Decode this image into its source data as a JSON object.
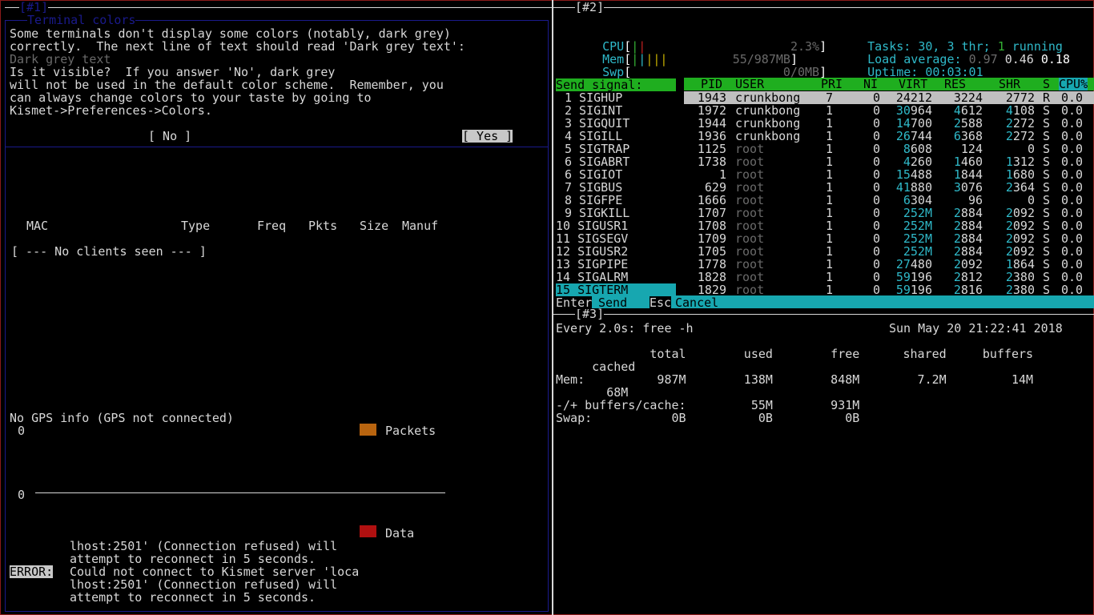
{
  "pane1": {
    "id": "[#1]",
    "dialog": {
      "title": "Terminal colors",
      "lines": [
        "Some terminals don't display some colors (notably, dark grey)",
        "correctly.  The next line of text should read 'Dark grey text':",
        "Dark grey text",
        "Is it visible?  If you answer 'No', dark grey",
        "will not be used in the default color scheme.  Remember, you",
        "can always change colors to your taste by going to",
        "Kismet->Preferences->Colors."
      ],
      "no_button": "[ No ]",
      "yes_button": "[ Yes ]"
    },
    "clients": {
      "headers": [
        "MAC",
        "Type",
        "Freq",
        "Pkts",
        "Size",
        "Manuf"
      ],
      "empty": "[ --- No clients seen --- ]"
    },
    "gps": "No GPS info (GPS not connected)",
    "graph": {
      "top_zero": "0",
      "mid_zero": "0",
      "legend_packets": "Packets",
      "legend_data": "Data",
      "packets_color": "#b8640f",
      "data_color": "#b01010"
    },
    "log": [
      "lhost:2501' (Connection refused) will",
      "attempt to reconnect in 5 seconds.",
      "Could not connect to Kismet server 'loca",
      "lhost:2501' (Connection refused) will",
      "attempt to reconnect in 5 seconds."
    ],
    "error_tag": "ERROR:"
  },
  "pane2": {
    "id": "[#2]",
    "meters": {
      "cpu_label": "CPU",
      "cpu_value": "2.3%",
      "mem_label": "Mem",
      "mem_value": "55/987MB",
      "swp_label": "Swp",
      "swp_value": "0/0MB"
    },
    "stats": {
      "tasks_label": "Tasks:",
      "tasks_value": "30,",
      "thr_value": "3",
      "thr_label": "thr;",
      "running_value": "1",
      "running_label": "running",
      "load_label": "Load average:",
      "load_1": "0.97",
      "load_5": "0.46",
      "load_15": "0.18",
      "uptime_label": "Uptime:",
      "uptime_value": "00:03:01"
    },
    "send_signal_title": "Send signal:",
    "signals": [
      "1 SIGHUP",
      "2 SIGINT",
      "3 SIGQUIT",
      "4 SIGILL",
      "5 SIGTRAP",
      "6 SIGABRT",
      "6 SIGIOT",
      "7 SIGBUS",
      "8 SIGFPE",
      "9 SIGKILL",
      "10 SIGUSR1",
      "11 SIGSEGV",
      "12 SIGUSR2",
      "13 SIGPIPE",
      "14 SIGALRM",
      "15 SIGTERM"
    ],
    "columns": [
      "PID",
      "USER",
      "PRI",
      "NI",
      "VIRT",
      "RES",
      "SHR",
      "S",
      "CPU%"
    ],
    "processes": [
      {
        "pid": "1943",
        "user": "crunkbong",
        "pri": "7",
        "ni": "0",
        "virt": "24212",
        "res": "3224",
        "shr": "2772",
        "s": "R",
        "cpu": "0.0"
      },
      {
        "pid": "1972",
        "user": "crunkbong",
        "pri": "1",
        "ni": "0",
        "virt": "30964",
        "res": "4612",
        "shr": "4108",
        "s": "S",
        "cpu": "0.0"
      },
      {
        "pid": "1944",
        "user": "crunkbong",
        "pri": "1",
        "ni": "0",
        "virt": "14700",
        "res": "2588",
        "shr": "2272",
        "s": "S",
        "cpu": "0.0"
      },
      {
        "pid": "1936",
        "user": "crunkbong",
        "pri": "1",
        "ni": "0",
        "virt": "26744",
        "res": "6368",
        "shr": "2272",
        "s": "S",
        "cpu": "0.0"
      },
      {
        "pid": "1125",
        "user": "root",
        "pri": "1",
        "ni": "0",
        "virt": "8608",
        "res": "124",
        "shr": "0",
        "s": "S",
        "cpu": "0.0"
      },
      {
        "pid": "1738",
        "user": "root",
        "pri": "1",
        "ni": "0",
        "virt": "4260",
        "res": "1460",
        "shr": "1312",
        "s": "S",
        "cpu": "0.0"
      },
      {
        "pid": "1",
        "user": "root",
        "pri": "1",
        "ni": "0",
        "virt": "15488",
        "res": "1844",
        "shr": "1680",
        "s": "S",
        "cpu": "0.0"
      },
      {
        "pid": "629",
        "user": "root",
        "pri": "1",
        "ni": "0",
        "virt": "41880",
        "res": "3076",
        "shr": "2364",
        "s": "S",
        "cpu": "0.0"
      },
      {
        "pid": "1666",
        "user": "root",
        "pri": "1",
        "ni": "0",
        "virt": "6304",
        "res": "96",
        "shr": "0",
        "s": "S",
        "cpu": "0.0"
      },
      {
        "pid": "1707",
        "user": "root",
        "pri": "1",
        "ni": "0",
        "virt": "252M",
        "res": "2884",
        "shr": "2092",
        "s": "S",
        "cpu": "0.0"
      },
      {
        "pid": "1708",
        "user": "root",
        "pri": "1",
        "ni": "0",
        "virt": "252M",
        "res": "2884",
        "shr": "2092",
        "s": "S",
        "cpu": "0.0"
      },
      {
        "pid": "1709",
        "user": "root",
        "pri": "1",
        "ni": "0",
        "virt": "252M",
        "res": "2884",
        "shr": "2092",
        "s": "S",
        "cpu": "0.0"
      },
      {
        "pid": "1705",
        "user": "root",
        "pri": "1",
        "ni": "0",
        "virt": "252M",
        "res": "2884",
        "shr": "2092",
        "s": "S",
        "cpu": "0.0"
      },
      {
        "pid": "1778",
        "user": "root",
        "pri": "1",
        "ni": "0",
        "virt": "27480",
        "res": "2092",
        "shr": "1864",
        "s": "S",
        "cpu": "0.0"
      },
      {
        "pid": "1828",
        "user": "root",
        "pri": "1",
        "ni": "0",
        "virt": "59196",
        "res": "2812",
        "shr": "2380",
        "s": "S",
        "cpu": "0.0"
      },
      {
        "pid": "1829",
        "user": "root",
        "pri": "1",
        "ni": "0",
        "virt": "59196",
        "res": "2816",
        "shr": "2380",
        "s": "S",
        "cpu": "0.0"
      }
    ],
    "footer": {
      "enter_key": "Enter",
      "enter_label": "Send",
      "esc_key": "Esc",
      "esc_label": "Cancel"
    }
  },
  "pane3": {
    "id": "[#3]",
    "watch_cmd": "Every 2.0s: free -h",
    "datetime": "Sun May 20 21:22:41 2018",
    "header_line1": "             total        used        free      shared     buffers",
    "header_line2": "     cached",
    "mem_line1": "Mem:          987M        138M        848M        7.2M         14M",
    "mem_line2": "       68M",
    "buffers_line": "-/+ buffers/cache:         55M        931M",
    "swap_line": "Swap:           0B          0B          0B"
  },
  "colors": {
    "htop_green": "#1fae1f",
    "htop_cyan": "#17a7b0",
    "kismet_blue": "#1a1a8c",
    "frame_red": "#8b1a1a"
  }
}
